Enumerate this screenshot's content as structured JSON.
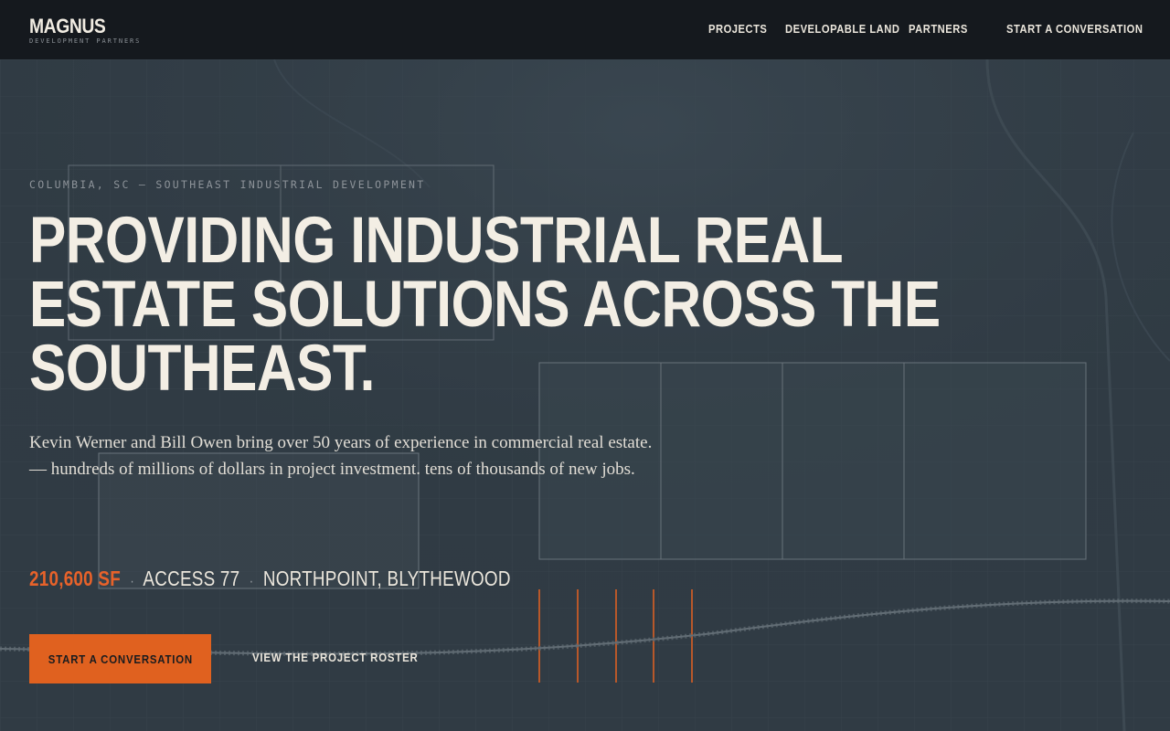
{
  "nav": {
    "logo_name": "MAGNUS",
    "logo_sub": "DEVELOPMENT PARTNERS",
    "links": [
      {
        "label": "PROJECTS"
      },
      {
        "label": "DEVELOPABLE LAND"
      },
      {
        "label": "PARTNERS"
      },
      {
        "label": "START A CONVERSATION"
      }
    ]
  },
  "hero": {
    "eyebrow": "COLUMBIA, SC — SOUTHEAST INDUSTRIAL DEVELOPMENT",
    "headline_lines": [
      "PROVIDING INDUSTRIAL REAL",
      "ESTATE SOLUTIONS ACROSS THE",
      "SOUTHEAST."
    ],
    "intro": "Kevin Werner and Bill Owen bring over 50 years of experience in commercial real estate. — hundreds of millions of dollars in project investment. tens of thousands of new jobs.",
    "stats": {
      "size": "210,600 SF",
      "separator": "·",
      "project": "ACCESS 77",
      "location": "NORTHPOINT, BLYTHEWOOD"
    },
    "cta_primary": "START A CONVERSATION",
    "cta_secondary": "VIEW THE PROJECT ROSTER"
  },
  "colors": {
    "nav_background": "#15191e",
    "hero_background": "#323e47",
    "accent": "#e0611f",
    "text_primary": "#f3eee4"
  }
}
